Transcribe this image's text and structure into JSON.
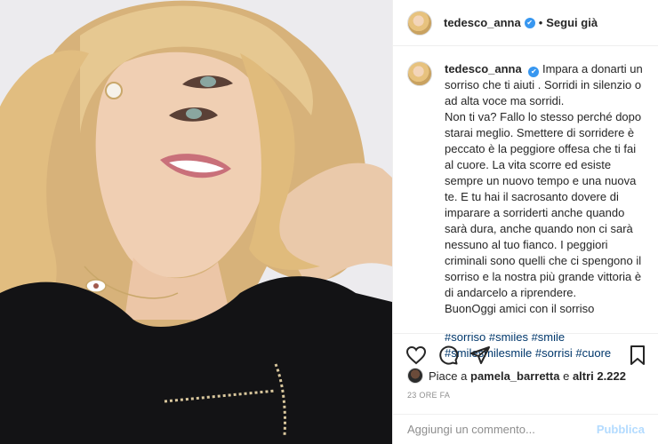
{
  "post": {
    "image_alt": "Portrait photo"
  },
  "header": {
    "username": "tedesco_anna",
    "verified_mark": "✔",
    "separator": "•",
    "follow_label": "Segui già"
  },
  "caption": {
    "username": "tedesco_anna",
    "lines": [
      "Impara a donarti un sorriso che ti aiuti . Sorridi in silenzio o ad alta voce ma sorridi.",
      "Non ti va? Fallo lo stesso perché dopo starai meglio. Smettere di sorridere è peccato è la peggiore offesa che ti fai al cuore. La vita scorre ed esiste sempre un nuovo tempo e una nuova te. E tu hai il sacrosanto dovere di imparare a sorriderti anche quando sarà dura, anche quando non ci sarà nessuno al tuo fianco. I peggiori criminali sono quelli che ci spengono il sorriso e la nostra più grande vittoria è di andarcelo a riprendere.",
      "BuonOggi amici con il sorriso"
    ],
    "hashtags": [
      "#sorriso",
      "#smiles",
      "#smile",
      "#smilesmilesmile",
      "#sorrisi",
      "#cuore"
    ]
  },
  "actions": {
    "like_icon": "heart-icon",
    "comment_icon": "comment-icon",
    "share_icon": "share-icon",
    "save_icon": "bookmark-icon"
  },
  "likes": {
    "prefix": "Piace a",
    "user": "pamela_barretta",
    "middle": "e",
    "others": "altri 2.222"
  },
  "timestamp": "23 ORE FA",
  "comment_box": {
    "placeholder": "Aggiungi un commento...",
    "publish_label": "Pubblica"
  },
  "colors": {
    "link": "#00376b",
    "verified": "#3897f0",
    "publish_disabled": "#b3dbff",
    "muted": "#8e8e8e"
  }
}
